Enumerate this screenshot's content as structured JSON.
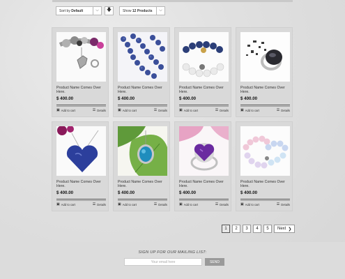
{
  "toolbar": {
    "sort_prefix": "Sort by",
    "sort_value": "Default",
    "show_prefix": "Show",
    "show_value": "12 Products"
  },
  "products": [
    {
      "name": "Product Name Comes Over Here.",
      "price": "$ 400.00",
      "image": "charm-bracelet"
    },
    {
      "name": "Product Name Comes Over Here.",
      "price": "$ 400.00",
      "image": "lapis-necklace"
    },
    {
      "name": "Product Name Comes Over Here.",
      "price": "$ 400.00",
      "image": "bead-bracelet"
    },
    {
      "name": "Product Name Comes Over Here.",
      "price": "$ 400.00",
      "image": "stone-ring"
    },
    {
      "name": "Product Name Comes Over Here.",
      "price": "$ 400.00",
      "image": "heart-pendant"
    },
    {
      "name": "Product Name Comes Over Here.",
      "price": "$ 400.00",
      "image": "turquoise-pendant"
    },
    {
      "name": "Product Name Comes Over Here.",
      "price": "$ 400.00",
      "image": "amethyst-ring"
    },
    {
      "name": "Product Name Comes Over Here.",
      "price": "$ 400.00",
      "image": "pastel-bracelets"
    }
  ],
  "card_actions": {
    "add_to_cart": "Add to cart",
    "details": "Details"
  },
  "pagination": {
    "pages": [
      "1",
      "2",
      "3",
      "4",
      "5"
    ],
    "active": "1",
    "next_label": "Next"
  },
  "footer": {
    "signup_title": "SIGN UP FOR OUR MAILING LIST:",
    "email_placeholder": "Your email here",
    "send_label": "SEND"
  }
}
